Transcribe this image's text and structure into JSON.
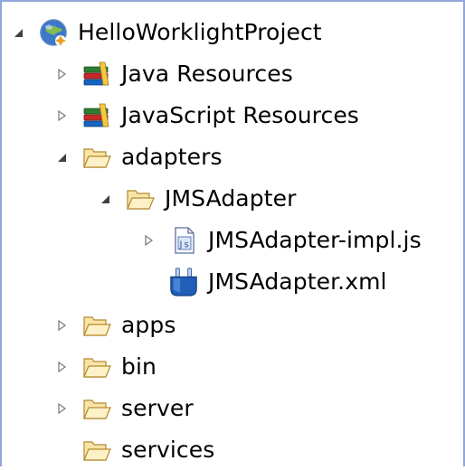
{
  "tree": {
    "project": {
      "label": "HelloWorklightProject",
      "expanded": true
    },
    "items": [
      {
        "label": "Java Resources",
        "icon": "library-icon",
        "twisty": "collapsed"
      },
      {
        "label": "JavaScript Resources",
        "icon": "library-icon",
        "twisty": "collapsed"
      },
      {
        "label": "adapters",
        "icon": "folder-icon",
        "twisty": "expanded"
      },
      {
        "label": "JMSAdapter",
        "icon": "folder-icon",
        "twisty": "expanded"
      },
      {
        "label": "JMSAdapter-impl.js",
        "icon": "js-file-icon",
        "twisty": "collapsed"
      },
      {
        "label": "JMSAdapter.xml",
        "icon": "adapter-xml-icon",
        "twisty": "none"
      },
      {
        "label": "apps",
        "icon": "folder-icon",
        "twisty": "collapsed"
      },
      {
        "label": "bin",
        "icon": "folder-icon",
        "twisty": "collapsed"
      },
      {
        "label": "server",
        "icon": "folder-icon",
        "twisty": "collapsed"
      },
      {
        "label": "services",
        "icon": "folder-icon",
        "twisty": "none"
      }
    ]
  }
}
